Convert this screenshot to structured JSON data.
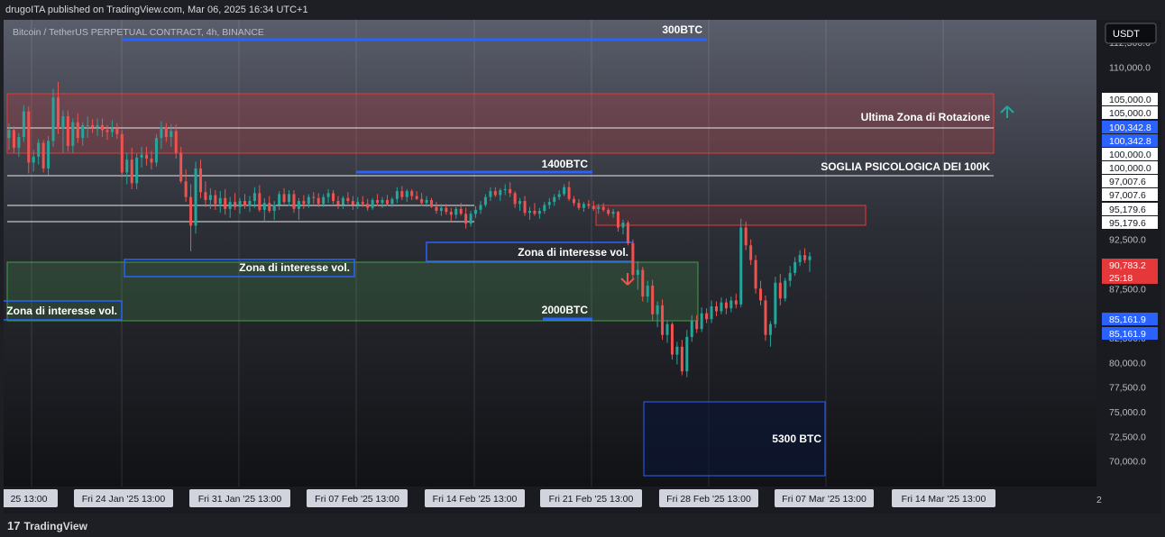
{
  "header": {
    "published": "drugoITA published on TradingView.com, Mar 06, 2025 16:34 UTC+1"
  },
  "footer": {
    "brand": "TradingView",
    "brand_mark": "17"
  },
  "chart_data": {
    "type": "candlestick",
    "title": "Bitcoin / TetherUS PERPETUAL CONTRACT, 4h, BINANCE",
    "currency": "USDT",
    "y_ticks": [
      "112,500.0",
      "110,000.0",
      "92,500.0",
      "87,500.0",
      "82,500.0",
      "80,000.0",
      "77,500.0",
      "75,000.0",
      "72,500.0",
      "70,000.0"
    ],
    "ylim": [
      67400,
      114800
    ],
    "x_ticks": [
      "25   13:00",
      "Fri 24 Jan '25   13:00",
      "Fri 31 Jan '25   13:00",
      "Fri 07 Feb '25   13:00",
      "Fri 14 Feb '25   13:00",
      "Fri 21 Feb '25   13:00",
      "Fri 28 Feb '25   13:00",
      "Fri 07 Mar '25   13:00",
      "Fri 14 Mar '25   13:00"
    ],
    "x_right": "2",
    "price_tags": [
      {
        "text": "105,000.0",
        "value": 105000,
        "style": "white"
      },
      {
        "text": "105,000.0",
        "value": 105000,
        "style": "white"
      },
      {
        "text": "100,342.8",
        "value": 100342.8,
        "style": "blue"
      },
      {
        "text": "100,342.8",
        "value": 100342.8,
        "style": "blue"
      },
      {
        "text": "100,000.0",
        "value": 100000,
        "style": "white"
      },
      {
        "text": "100,000.0",
        "value": 100000,
        "style": "white"
      },
      {
        "text": "97,007.6",
        "value": 97007.6,
        "style": "white"
      },
      {
        "text": "97,007.6",
        "value": 97007.6,
        "style": "white"
      },
      {
        "text": "95,179.6",
        "value": 95179.6,
        "style": "white"
      },
      {
        "text": "95,179.6",
        "value": 95179.6,
        "style": "white"
      },
      {
        "text": "90,783.2",
        "value": 90783.2,
        "style": "red"
      },
      {
        "text": "25:18",
        "value": 90783.2,
        "style": "red"
      },
      {
        "text": "85,161.9",
        "value": 85161.9,
        "style": "blue"
      },
      {
        "text": "85,161.9",
        "value": 85161.9,
        "style": "blue"
      }
    ],
    "annotations": {
      "btc300": "300BTC",
      "btc1400": "1400BTC",
      "btc2000": "2000BTC",
      "btc5300": "5300 BTC",
      "rotation": "Ultima Zona di Rotazione",
      "psych": "SOGLIA PSICOLOGICA DEI 100K",
      "vol1": "Zona di interesse vol.",
      "vol2": "Zona di interesse vol.",
      "vol3": "Zona di interesse vol."
    },
    "colors": {
      "up": "#26a69a",
      "down": "#ef5350",
      "blue": "#2962ff",
      "red_zone": "#e5383b",
      "green_zone": "#43a047"
    },
    "series": [
      {
        "name": "",
        "values": [
          [
            102800,
            104300,
            101600,
            103600
          ],
          [
            103600,
            104000,
            101300,
            101800
          ],
          [
            101800,
            103300,
            100900,
            102900
          ],
          [
            102900,
            106100,
            102400,
            105500
          ],
          [
            105500,
            106000,
            99200,
            100300
          ],
          [
            100300,
            101600,
            99400,
            100900
          ],
          [
            100900,
            102700,
            100100,
            102300
          ],
          [
            102300,
            102600,
            99300,
            99700
          ],
          [
            99700,
            103000,
            99000,
            102500
          ],
          [
            102500,
            107800,
            101900,
            106900
          ],
          [
            106900,
            108500,
            103200,
            103800
          ],
          [
            103800,
            105600,
            101300,
            105000
          ],
          [
            105000,
            105600,
            101400,
            102000
          ],
          [
            102000,
            104800,
            101300,
            104400
          ],
          [
            104400,
            105300,
            102300,
            102800
          ],
          [
            102800,
            104400,
            102000,
            104100
          ],
          [
            104100,
            105000,
            102800,
            104100
          ],
          [
            104100,
            104700,
            103300,
            103900
          ],
          [
            103900,
            104800,
            103000,
            104100
          ],
          [
            104100,
            104800,
            102900,
            103600
          ],
          [
            103600,
            104100,
            102600,
            103400
          ],
          [
            103400,
            104600,
            102900,
            103800
          ],
          [
            103800,
            104300,
            102700,
            103200
          ],
          [
            103200,
            103600,
            98800,
            99300
          ],
          [
            99300,
            101300,
            98100,
            100600
          ],
          [
            100600,
            101800,
            97600,
            98200
          ],
          [
            98200,
            101200,
            97600,
            100800
          ],
          [
            100800,
            101900,
            99800,
            101100
          ],
          [
            101100,
            101900,
            100000,
            100700
          ],
          [
            100700,
            101500,
            99600,
            100300
          ],
          [
            100300,
            103200,
            99900,
            102800
          ],
          [
            102800,
            104500,
            101700,
            103900
          ],
          [
            103900,
            104300,
            102400,
            102900
          ],
          [
            102900,
            104200,
            101900,
            103500
          ],
          [
            103500,
            104200,
            100700,
            101300
          ],
          [
            101300,
            101900,
            98200,
            98400
          ],
          [
            98400,
            99600,
            96300,
            96800
          ],
          [
            96800,
            98100,
            91300,
            93900
          ],
          [
            93900,
            100400,
            93100,
            99700
          ],
          [
            99700,
            100600,
            96700,
            97300
          ],
          [
            97300,
            98400,
            95800,
            96500
          ],
          [
            96500,
            97700,
            95600,
            97000
          ],
          [
            97000,
            97500,
            95500,
            96100
          ],
          [
            96100,
            97400,
            95200,
            96700
          ],
          [
            96700,
            97600,
            95000,
            95600
          ],
          [
            95600,
            96800,
            94700,
            96300
          ],
          [
            96300,
            97200,
            95500,
            95800
          ],
          [
            95800,
            96700,
            95100,
            96400
          ],
          [
            96400,
            97100,
            95600,
            95900
          ],
          [
            95900,
            96900,
            95300,
            96400
          ],
          [
            96400,
            97800,
            95700,
            97200
          ],
          [
            97200,
            98000,
            95300,
            95500
          ],
          [
            95500,
            96700,
            94400,
            96200
          ],
          [
            96200,
            96900,
            95200,
            95400
          ],
          [
            95400,
            96400,
            94500,
            96000
          ],
          [
            96000,
            97400,
            95500,
            97100
          ],
          [
            97100,
            97700,
            96100,
            96300
          ],
          [
            96300,
            97500,
            95900,
            97100
          ],
          [
            97100,
            97500,
            95200,
            95600
          ],
          [
            95600,
            96700,
            94500,
            96400
          ],
          [
            96400,
            97000,
            95600,
            96100
          ],
          [
            96100,
            97100,
            95700,
            96800
          ],
          [
            96800,
            97300,
            96100,
            96700
          ],
          [
            96700,
            97200,
            95800,
            96100
          ],
          [
            96100,
            97100,
            95800,
            96800
          ],
          [
            96800,
            97600,
            96200,
            97200
          ],
          [
            97200,
            97500,
            96100,
            96400
          ],
          [
            96400,
            96900,
            95600,
            96000
          ],
          [
            96000,
            96900,
            95600,
            96700
          ],
          [
            96700,
            97300,
            96100,
            96400
          ],
          [
            96400,
            96900,
            95500,
            96000
          ],
          [
            96000,
            96800,
            95600,
            96300
          ],
          [
            96300,
            96900,
            95800,
            96100
          ],
          [
            96100,
            96600,
            95400,
            95700
          ],
          [
            95700,
            96700,
            95500,
            96500
          ],
          [
            96500,
            97100,
            95900,
            96200
          ],
          [
            96200,
            96800,
            95700,
            96500
          ],
          [
            96500,
            97000,
            95900,
            96100
          ],
          [
            96100,
            96800,
            95800,
            96600
          ],
          [
            96600,
            97800,
            96200,
            97400
          ],
          [
            97400,
            97900,
            96500,
            96800
          ],
          [
            96800,
            97600,
            96300,
            97400
          ],
          [
            97400,
            97600,
            96500,
            96900
          ],
          [
            96900,
            97400,
            96500,
            96600
          ],
          [
            96600,
            97200,
            95900,
            96200
          ],
          [
            96200,
            96900,
            95800,
            96500
          ],
          [
            96500,
            96700,
            95700,
            95800
          ],
          [
            95800,
            96300,
            95100,
            95400
          ],
          [
            95400,
            96100,
            94900,
            95700
          ],
          [
            95700,
            96100,
            95000,
            95300
          ],
          [
            95300,
            95700,
            94400,
            95000
          ],
          [
            95000,
            95800,
            94600,
            95600
          ],
          [
            95600,
            96200,
            94900,
            95100
          ],
          [
            95100,
            95700,
            93600,
            94100
          ],
          [
            94100,
            95400,
            93800,
            95100
          ],
          [
            95100,
            95900,
            94700,
            95500
          ],
          [
            95500,
            96400,
            95100,
            96000
          ],
          [
            96000,
            97100,
            95800,
            96800
          ],
          [
            96800,
            97800,
            96400,
            97400
          ],
          [
            97400,
            97800,
            96800,
            97000
          ],
          [
            97000,
            97700,
            96400,
            97500
          ],
          [
            97500,
            98100,
            97000,
            97600
          ],
          [
            97600,
            98300,
            96800,
            97200
          ],
          [
            97200,
            97400,
            95700,
            96100
          ],
          [
            96100,
            96700,
            95400,
            96400
          ],
          [
            96400,
            96900,
            94900,
            95200
          ],
          [
            95200,
            95800,
            94500,
            95400
          ],
          [
            95400,
            96200,
            94900,
            95100
          ],
          [
            95100,
            95700,
            94600,
            95400
          ],
          [
            95400,
            96300,
            95100,
            96000
          ],
          [
            96000,
            96700,
            95600,
            96300
          ],
          [
            96300,
            97100,
            95900,
            96800
          ],
          [
            96800,
            97500,
            96500,
            97100
          ],
          [
            97100,
            98100,
            96900,
            97800
          ],
          [
            97800,
            98400,
            96400,
            96600
          ],
          [
            96600,
            96900,
            95900,
            96200
          ],
          [
            96200,
            96600,
            95500,
            95700
          ],
          [
            95700,
            96300,
            95300,
            96100
          ],
          [
            96100,
            96500,
            95600,
            95900
          ],
          [
            95900,
            96400,
            95400,
            95600
          ],
          [
            95600,
            96100,
            95100,
            95800
          ],
          [
            95800,
            96200,
            95300,
            95500
          ],
          [
            95500,
            95700,
            94900,
            95100
          ],
          [
            95100,
            95600,
            94700,
            95300
          ],
          [
            95300,
            95400,
            93300,
            93700
          ],
          [
            93700,
            94500,
            93000,
            94200
          ],
          [
            94200,
            94400,
            91900,
            92100
          ],
          [
            92100,
            92500,
            88400,
            88900
          ],
          [
            88900,
            90300,
            87400,
            89400
          ],
          [
            89400,
            89700,
            86200,
            86700
          ],
          [
            86700,
            88300,
            86100,
            87800
          ],
          [
            87800,
            88400,
            84300,
            84900
          ],
          [
            84900,
            86200,
            83600,
            85800
          ],
          [
            85800,
            86400,
            82300,
            82800
          ],
          [
            82800,
            84300,
            82000,
            83900
          ],
          [
            83900,
            84100,
            80300,
            80800
          ],
          [
            80800,
            82100,
            79800,
            81600
          ],
          [
            81600,
            82300,
            78700,
            79100
          ],
          [
            79100,
            83300,
            78500,
            82600
          ],
          [
            82600,
            84800,
            82100,
            84200
          ],
          [
            84200,
            84800,
            83000,
            83400
          ],
          [
            83400,
            85600,
            83100,
            85000
          ],
          [
            85000,
            85500,
            84000,
            84400
          ],
          [
            84400,
            86300,
            84000,
            85700
          ],
          [
            85700,
            86200,
            84700,
            85200
          ],
          [
            85200,
            86600,
            84900,
            86100
          ],
          [
            86100,
            86500,
            84900,
            85500
          ],
          [
            85500,
            86700,
            85100,
            86300
          ],
          [
            86300,
            87000,
            85500,
            85900
          ],
          [
            85900,
            94600,
            85600,
            93700
          ],
          [
            93700,
            94300,
            91400,
            91900
          ],
          [
            91900,
            92500,
            89900,
            90400
          ],
          [
            90400,
            90900,
            87000,
            87500
          ],
          [
            87500,
            88300,
            85800,
            86300
          ],
          [
            86300,
            86800,
            82200,
            82800
          ],
          [
            82800,
            84200,
            81600,
            83900
          ],
          [
            83900,
            88700,
            83500,
            88100
          ],
          [
            88100,
            89000,
            85800,
            86500
          ],
          [
            86500,
            88600,
            86200,
            88300
          ],
          [
            88300,
            89800,
            87700,
            89100
          ],
          [
            89100,
            90700,
            88800,
            90200
          ],
          [
            90200,
            91400,
            89800,
            90900
          ],
          [
            90900,
            91600,
            90100,
            90400
          ],
          [
            90400,
            91200,
            89200,
            90783
          ]
        ]
      }
    ]
  }
}
